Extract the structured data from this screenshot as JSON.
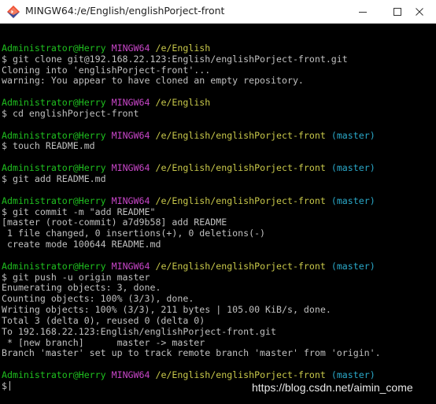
{
  "window": {
    "title": "MINGW64:/e/English/englishPorject-front",
    "icon": "git-bash-icon",
    "controls": [
      "minimize-icon",
      "maximize-icon",
      "close-icon"
    ]
  },
  "colors": {
    "background": "#000000",
    "text": "#c0c0c0",
    "user_host": "#1fc01f",
    "mingw": "#c846c8",
    "path": "#c8c84a",
    "branch": "#2aa8c8"
  },
  "prompt": {
    "user_host": "Administrator@Herry",
    "system": "MINGW64",
    "branch": "(master)"
  },
  "terminal": {
    "l1": {
      "path": "/e/English"
    },
    "l2": {
      "text": "$ git clone git@192.168.22.123:English/englishPorject-front.git"
    },
    "l3": {
      "text": "Cloning into 'englishPorject-front'..."
    },
    "l4": {
      "text": "warning: You appear to have cloned an empty repository."
    },
    "l6": {
      "path": "/e/English"
    },
    "l7": {
      "text": "$ cd englishPorject-front"
    },
    "l9": {
      "path": "/e/English/englishPorject-front"
    },
    "l10": {
      "text": "$ touch README.md"
    },
    "l12": {
      "path": "/e/English/englishPorject-front"
    },
    "l13": {
      "text": "$ git add README.md"
    },
    "l15": {
      "path": "/e/English/englishPorject-front"
    },
    "l16": {
      "text": "$ git commit -m \"add README\""
    },
    "l17": {
      "text": "[master (root-commit) a7d9b58] add README"
    },
    "l18": {
      "text": " 1 file changed, 0 insertions(+), 0 deletions(-)"
    },
    "l19": {
      "text": " create mode 100644 README.md"
    },
    "l21": {
      "path": "/e/English/englishPorject-front"
    },
    "l22": {
      "text": "$ git push -u origin master"
    },
    "l23": {
      "text": "Enumerating objects: 3, done."
    },
    "l24": {
      "text": "Counting objects: 100% (3/3), done."
    },
    "l25": {
      "text": "Writing objects: 100% (3/3), 211 bytes | 105.00 KiB/s, done."
    },
    "l26": {
      "text": "Total 3 (delta 0), reused 0 (delta 0)"
    },
    "l27": {
      "text": "To 192.168.22.123:English/englishPorject-front.git"
    },
    "l28": {
      "text": " * [new branch]      master -> master"
    },
    "l29": {
      "text": "Branch 'master' set up to track remote branch 'master' from 'origin'."
    },
    "l31": {
      "path": "/e/English/englishPorject-front"
    },
    "l32": {
      "text": "$"
    }
  },
  "watermark": "https://blog.csdn.net/aimin_come"
}
